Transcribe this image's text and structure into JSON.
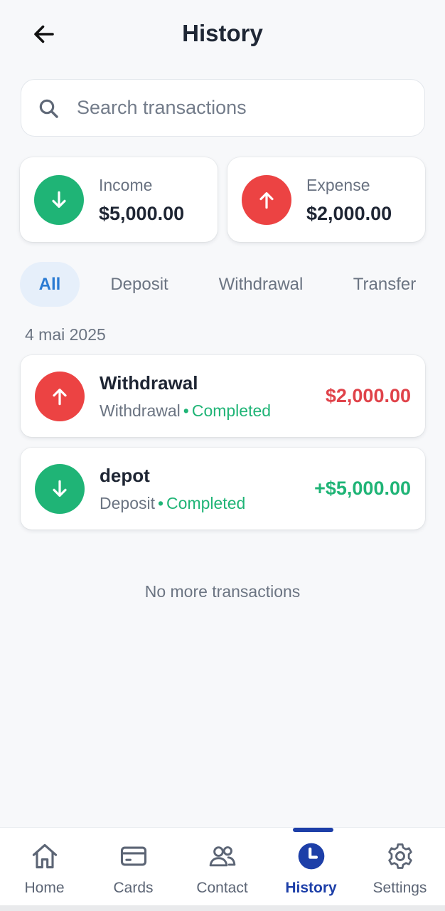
{
  "header": {
    "title": "History",
    "back_icon": "arrow-left-icon"
  },
  "search": {
    "placeholder": "Search transactions",
    "value": "",
    "icon": "search-icon"
  },
  "summary": {
    "income": {
      "label": "Income",
      "amount": "$5,000.00",
      "icon": "arrow-down-icon",
      "color": "#1fb476"
    },
    "expense": {
      "label": "Expense",
      "amount": "$2,000.00",
      "icon": "arrow-up-icon",
      "color": "#ec4343"
    }
  },
  "filters": {
    "tabs": [
      {
        "label": "All",
        "active": true
      },
      {
        "label": "Deposit",
        "active": false
      },
      {
        "label": "Withdrawal",
        "active": false
      },
      {
        "label": "Transfer",
        "active": false
      }
    ]
  },
  "transactions": {
    "date_label": "4 mai 2025",
    "items": [
      {
        "title": "Withdrawal",
        "type": "Withdrawal",
        "separator": "•",
        "status": "Completed",
        "amount": "$2,000.00",
        "icon": "arrow-up-icon",
        "amount_color": "#e0434a"
      },
      {
        "title": "depot",
        "type": "Deposit",
        "separator": "•",
        "status": "Completed",
        "amount": "+$5,000.00",
        "icon": "arrow-down-icon",
        "amount_color": "#1fb476"
      }
    ],
    "end_text": "No more transactions"
  },
  "bottom_nav": {
    "items": [
      {
        "label": "Home",
        "icon": "home-icon",
        "active": false
      },
      {
        "label": "Cards",
        "icon": "card-icon",
        "active": false
      },
      {
        "label": "Contact",
        "icon": "contacts-icon",
        "active": false
      },
      {
        "label": "History",
        "icon": "clock-icon",
        "active": true
      },
      {
        "label": "Settings",
        "icon": "gear-icon",
        "active": false
      }
    ]
  },
  "colors": {
    "accent": "#1d3fa8",
    "income": "#1fb476",
    "expense": "#ec4343",
    "tab_active": "#2b7bd3"
  }
}
